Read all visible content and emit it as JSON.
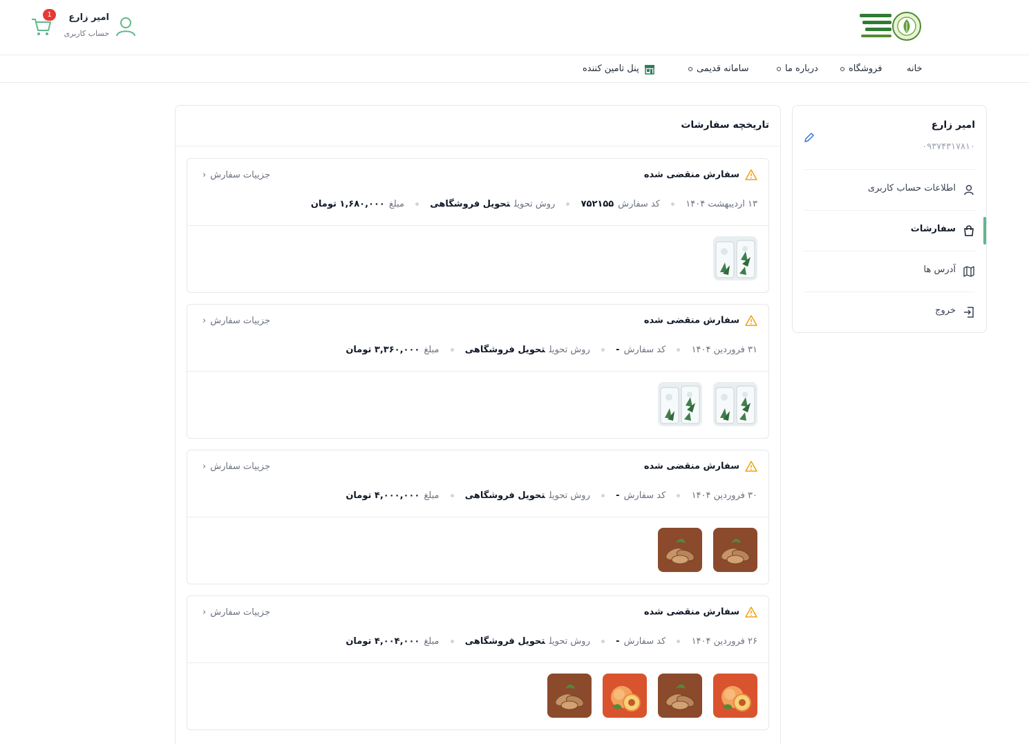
{
  "header": {
    "user_name": "امیر زارع",
    "user_sub": "حساب کاربری",
    "cart_count": "1",
    "logo_name": "logo"
  },
  "nav": {
    "items": [
      {
        "label": "خانه",
        "dot": false
      },
      {
        "label": "فروشگاه",
        "dot": true
      },
      {
        "label": "درباره ما",
        "dot": true
      },
      {
        "label": "سامانه قدیمی",
        "dot": true
      },
      {
        "label": "پنل تامین کننده",
        "icon": "store-icon"
      }
    ]
  },
  "sidebar": {
    "name": "امیر زارع",
    "phone": "۰۹۳۷۴۳۱۷۸۱۰",
    "items": [
      {
        "label": "اطلاعات حساب کاربری",
        "icon": "user-icon"
      },
      {
        "label": "سفارشات",
        "icon": "bag-icon",
        "active": true
      },
      {
        "label": "آدرس ها",
        "icon": "map-icon"
      },
      {
        "label": "خروج",
        "icon": "logout-icon"
      }
    ]
  },
  "main": {
    "title": "تاریخچه سفارشات",
    "labels": {
      "status": "سفارش منقضی شده",
      "details": "جزییات سفارش",
      "code": "کد سفارش",
      "delivery": "روش تحویل",
      "amount": "مبلغ"
    },
    "orders": [
      {
        "date": "۱۳ اردیبهشت ۱۴۰۴",
        "code": "۷۵۲۱۵۵",
        "delivery": "تحویل فروشگاهی",
        "amount": "۱,۶۸۰,۰۰۰ تومان",
        "thumbs": [
          "aloe"
        ]
      },
      {
        "date": "۳۱ فروردین ۱۴۰۴",
        "code": "-",
        "delivery": "تحویل فروشگاهی",
        "amount": "۳,۳۶۰,۰۰۰ تومان",
        "thumbs": [
          "aloe",
          "aloe"
        ]
      },
      {
        "date": "۳۰ فروردین ۱۴۰۴",
        "code": "-",
        "delivery": "تحویل فروشگاهی",
        "amount": "۴,۰۰۰,۰۰۰ تومان",
        "thumbs": [
          "almond",
          "almond"
        ]
      },
      {
        "date": "۲۶ فروردین ۱۴۰۴",
        "code": "-",
        "delivery": "تحویل فروشگاهی",
        "amount": "۴,۰۰۴,۰۰۰ تومان",
        "thumbs": [
          "peach",
          "almond",
          "peach",
          "almond"
        ]
      }
    ]
  },
  "colors": {
    "accent": "#5cb88a",
    "warning": "#f59e0b",
    "badge": "#e53935",
    "almond_bg": "#8b4a2b",
    "peach_bg": "#d9532e"
  }
}
